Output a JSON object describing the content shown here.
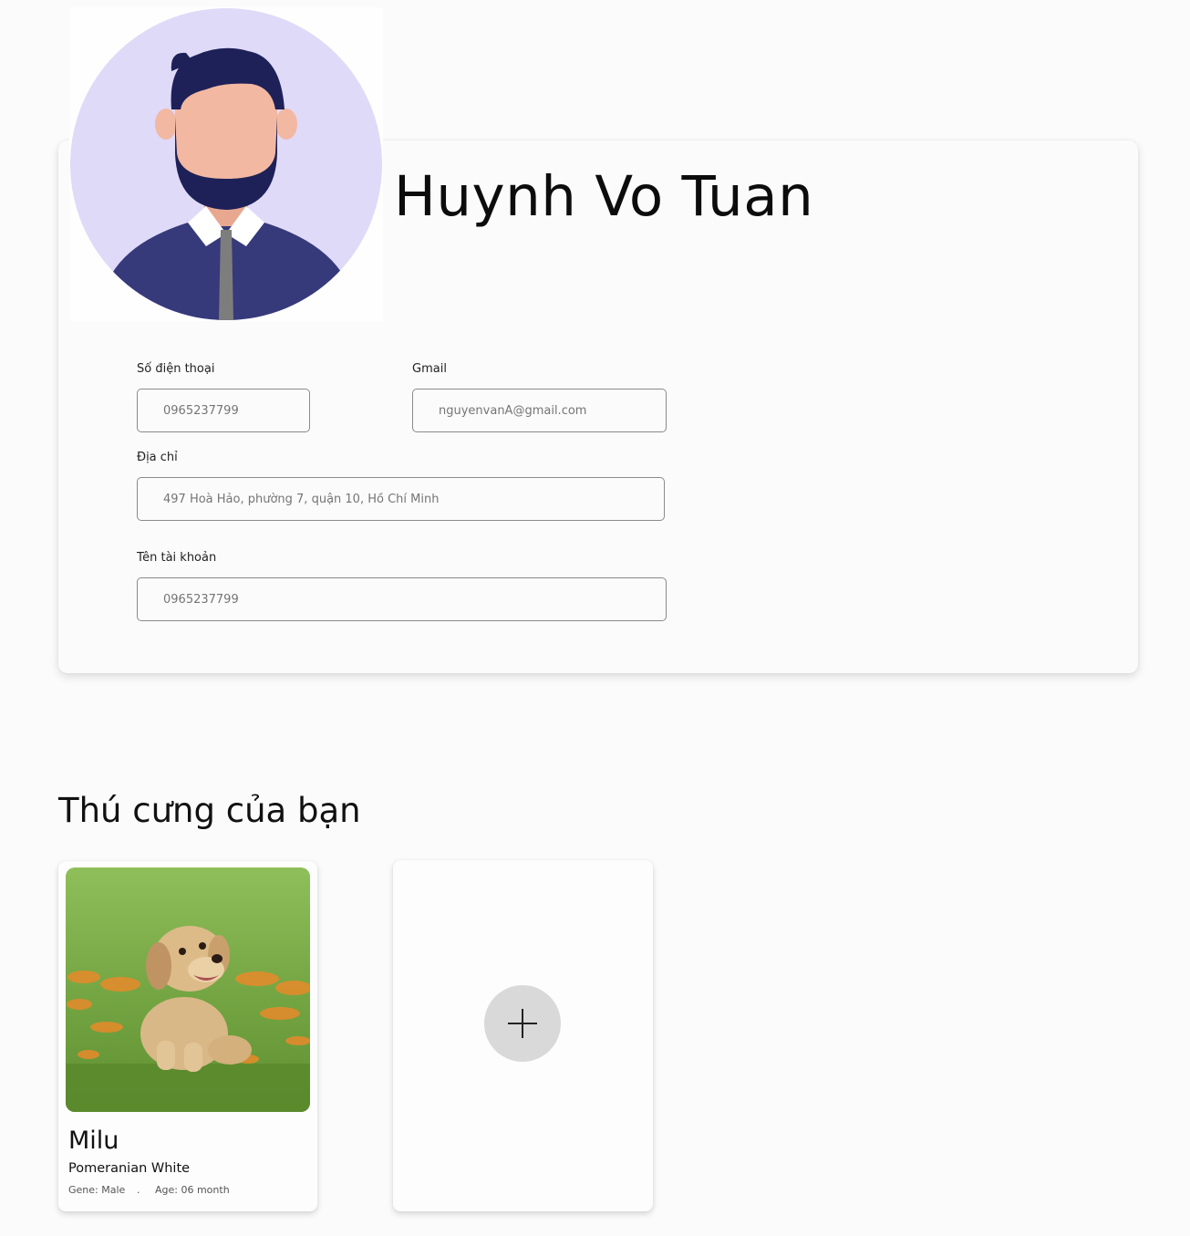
{
  "profile": {
    "name": "Huynh Vo Tuan",
    "avatar_icon": "user-avatar-illustration",
    "fields": {
      "phone": {
        "label": "Số điện thoại",
        "placeholder": "0965237799"
      },
      "gmail": {
        "label": "Gmail",
        "placeholder": "nguyenvanA@gmail.com"
      },
      "address": {
        "label": "Địa chỉ",
        "placeholder": "497 Hoà Hảo, phường 7, quận 10, Hồ Chí Minh"
      },
      "account": {
        "label": "Tên tài khoản",
        "placeholder": "0965237799"
      }
    }
  },
  "pets": {
    "title": "Thú cưng của bạn",
    "items": [
      {
        "name": "Milu",
        "breed": "Pomeranian White",
        "gene": "Gene: Male",
        "separator": ".",
        "age": "Age: 06 month",
        "photo_icon": "puppy-photo"
      }
    ],
    "add_icon": "plus-icon"
  },
  "colors": {
    "avatar_bg": "#dfdaf8",
    "shirt": "#36397a",
    "hair": "#1e2158",
    "skin": "#f2b8a2",
    "add_button_bg": "#d9d9d9"
  }
}
